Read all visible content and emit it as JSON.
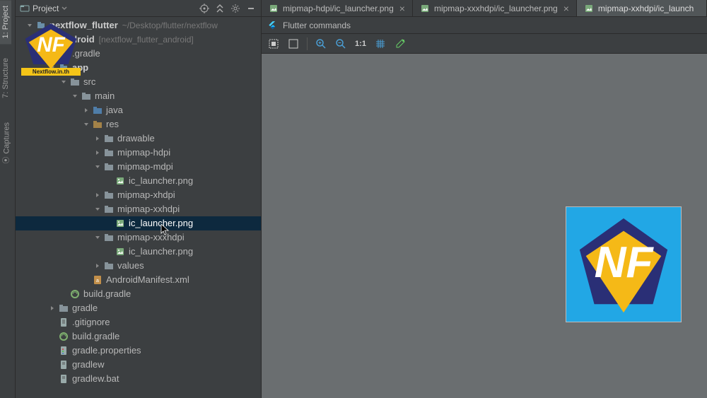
{
  "sidebar_tabs": {
    "project": "1: Project",
    "structure": "7: Structure",
    "captures": "Captures"
  },
  "panel": {
    "title": "Project"
  },
  "tree": {
    "root": {
      "name": "nextflow_flutter",
      "hint": "~/Desktop/flutter/nextflow"
    },
    "android": {
      "name": "android",
      "hint": "[nextflow_flutter_android]"
    },
    "gradle_dir": ".gradle",
    "app": "app",
    "src": "src",
    "main": "main",
    "java": "java",
    "res": "res",
    "drawable": "drawable",
    "mipmap_hdpi": "mipmap-hdpi",
    "mipmap_mdpi": "mipmap-mdpi",
    "ic1": "ic_launcher.png",
    "mipmap_xhdpi": "mipmap-xhdpi",
    "mipmap_xxhdpi": "mipmap-xxhdpi",
    "ic2": "ic_launcher.png",
    "mipmap_xxxhdpi": "mipmap-xxxhdpi",
    "ic3": "ic_launcher.png",
    "values": "values",
    "manifest": "AndroidManifest.xml",
    "build_gradle_app": "build.gradle",
    "gradle_root": "gradle",
    "gitignore": ".gitignore",
    "build_gradle_root": "build.gradle",
    "gradle_properties": "gradle.properties",
    "gradlew": "gradlew",
    "gradlew_bat": "gradlew.bat"
  },
  "tabs": {
    "t1": "mipmap-hdpi/ic_launcher.png",
    "t2": "mipmap-xxxhdpi/ic_launcher.png",
    "t3": "mipmap-xxhdpi/ic_launch"
  },
  "commands": "Flutter commands",
  "watermark": {
    "text": "NF",
    "caption": "Nextflow.in.th"
  }
}
